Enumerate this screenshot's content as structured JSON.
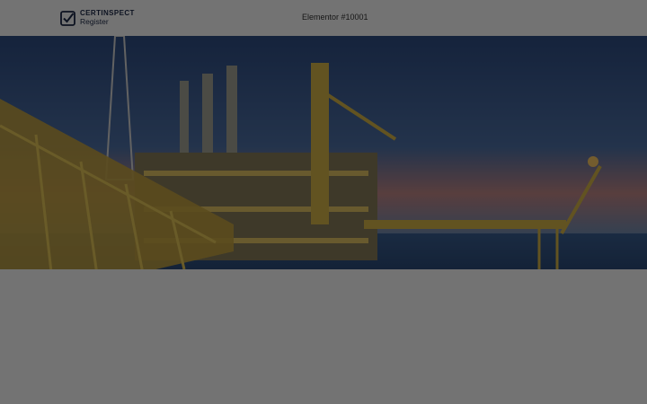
{
  "logo": {
    "line1": "CERTINSPECT",
    "line2": "Register",
    "icon": "checkbox-check-icon"
  },
  "header": {
    "site_title": "Elementor #10001"
  },
  "hero": {
    "image": "offshore-oil-rig-photo"
  },
  "colors": {
    "overlay": "#000000",
    "brand": "#1d2a4a",
    "sky_top": "#2f4e85",
    "sea": "#1f3a63",
    "structure": "#d9b94a"
  }
}
